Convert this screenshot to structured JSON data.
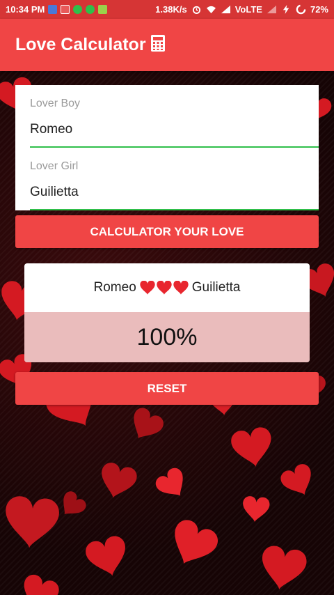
{
  "status_bar": {
    "time": "10:34 PM",
    "speed": "1.38K/s",
    "network": "VoLTE",
    "battery": "72%"
  },
  "app": {
    "title": "Love Calculator",
    "icon": "calculator-icon"
  },
  "form": {
    "boy_label": "Lover Boy",
    "boy_value": "Romeo",
    "girl_label": "Lover Girl",
    "girl_value": "Guilietta",
    "calculate_label": "CALCULATOR YOUR LOVE"
  },
  "result": {
    "name1": "Romeo",
    "name2": "Guilietta",
    "hearts": 3,
    "percent": "100%"
  },
  "reset_label": "RESET",
  "colors": {
    "primary": "#f04545",
    "status_bar": "#d63535",
    "field_underline": "#2fbf4a",
    "percent_bg": "#eabcbc",
    "heart": "#e8262e"
  }
}
